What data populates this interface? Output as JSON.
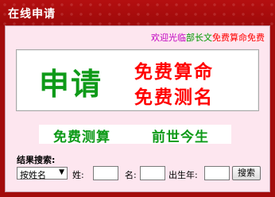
{
  "header": {
    "title": "在线申请"
  },
  "marquee": {
    "part1": "欢迎光临",
    "part2": "部长文",
    "part3": "免费算命免费"
  },
  "banner": {
    "big": "申请",
    "line1": "免费算命",
    "line2": "免费测名"
  },
  "strip": {
    "left": "免费测算",
    "right": "前世今生"
  },
  "search": {
    "label": "结果搜索:",
    "select_value": "按姓名",
    "surname_label": "姓:",
    "name_label": "名:",
    "birthyear_label": "出生年:",
    "button_label": "搜索"
  },
  "colors": {
    "frame": "#a30c0c",
    "panel": "#fde6ef",
    "green": "#0e9a18",
    "red": "#ff0000"
  }
}
